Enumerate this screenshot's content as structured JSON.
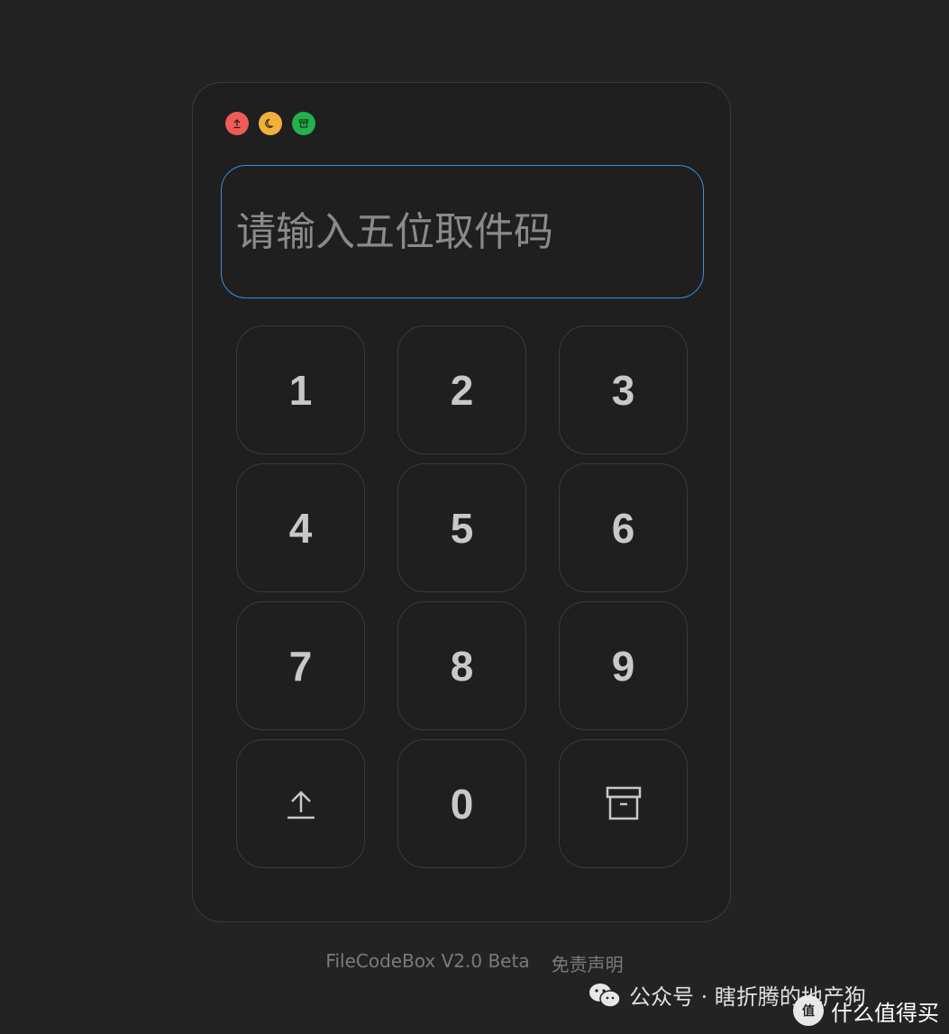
{
  "window_controls": [
    {
      "name": "upload",
      "color": "#ee5c56"
    },
    {
      "name": "theme-moon",
      "color": "#f0b03c"
    },
    {
      "name": "archive",
      "color": "#22b14c"
    }
  ],
  "input": {
    "placeholder": "请输入五位取件码",
    "value": ""
  },
  "keypad": {
    "keys": [
      "1",
      "2",
      "3",
      "4",
      "5",
      "6",
      "7",
      "8",
      "9"
    ],
    "bottom_left_icon": "upload-icon",
    "bottom_middle": "0",
    "bottom_right_icon": "archive-icon"
  },
  "footer": {
    "version": "FileCodeBox V2.0 Beta",
    "disclaimer": "免责声明"
  },
  "watermark": {
    "text": "公众号 · 瞎折腾的地产狗",
    "text2": "什么值得买"
  },
  "colors": {
    "background": "#232323",
    "card": "#1f1f1f",
    "accent_border": "#3d8ed8"
  }
}
